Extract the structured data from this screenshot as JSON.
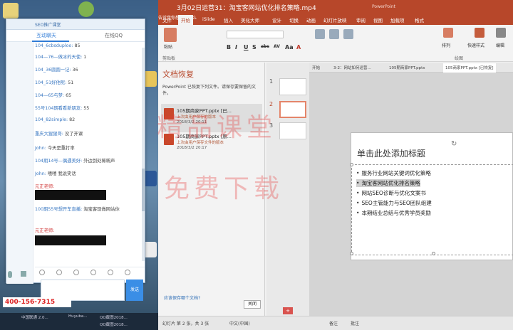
{
  "window_title": "3月02日运营31：淘宝客网站优化排名策略.mp4",
  "app_name": "PowerPoint",
  "chat": {
    "title": "SEO推广课堂",
    "tabs": [
      "互动聊天",
      "在线QQ"
    ],
    "messages": [
      {
        "user": "104_6cbsduploo:",
        "text": "85",
        "red": false
      },
      {
        "user": "104—76—做冰的天使:",
        "text": "1",
        "red": false
      },
      {
        "user": "104_36圆圆一记:",
        "text": "36",
        "red": false
      },
      {
        "user": "104_51好他呢:",
        "text": "51",
        "red": false
      },
      {
        "user": "104—65与梦:",
        "text": "65",
        "red": false
      },
      {
        "user": "55号104期看看新朋友:",
        "text": "55",
        "red": false
      },
      {
        "user": "104_82simple:",
        "text": "82",
        "red": false
      },
      {
        "user": "重庆大猩猩哥:",
        "text": "没了开课",
        "red": false
      },
      {
        "user": "John:",
        "text": "今天是重打率",
        "red": false
      },
      {
        "user": "104期14号—偶遇美好:",
        "text": "外边到处稀稀声",
        "red": false
      },
      {
        "user": "John:",
        "text": "嘻嘻 我说笑话",
        "red": false
      },
      {
        "user": "元正老师:",
        "text": "",
        "red": true
      },
      {
        "user": "100期55号想开车直播:",
        "text": "淘宝客现做网站你",
        "red": false
      },
      {
        "user": "元正老师:",
        "text": "",
        "red": true
      }
    ],
    "send_label": "发送"
  },
  "ribbon": {
    "tabs": [
      "文件",
      "开始",
      "iSlide",
      "插入",
      "美化大师",
      "设计",
      "切换",
      "动画",
      "幻灯片放映",
      "审阅",
      "视图",
      "加载项",
      "格式"
    ],
    "active_tab": "开始",
    "search_hint": "告诉我你想要做什么",
    "paste_label": "粘贴",
    "clipboard_group": "剪贴板",
    "draw_group": "绘图",
    "font_letters": [
      "B",
      "I",
      "U",
      "S",
      "abc",
      "AV",
      "Aa",
      "A"
    ],
    "align_label": "排列",
    "quick_style": "快速样式",
    "edit_label": "编辑"
  },
  "recovery": {
    "title": "文档恢复",
    "description": "PowerPoint 已恢复下列文件。请保存要保留的文件。",
    "items": [
      {
        "name": "105期商家PPT.pptx [已...",
        "sub": "上次由用户保存的版本",
        "time": "2018/3/2 20:11",
        "selected": true
      },
      {
        "name": "105期商家PPT.pptx [原...",
        "sub": "上次由用户保存文件的版本",
        "time": "2018/3/2 20:17",
        "selected": false
      }
    ],
    "help": "应该保存哪个文档?",
    "close": "关闭"
  },
  "doc_tabs": [
    "开始",
    "3-2：网站如何运营...",
    "105期商家PPT.pptx",
    "105商家PPT.pptx [已恢复]"
  ],
  "thumb_numbers": [
    "1",
    "2",
    "3"
  ],
  "slide": {
    "title": "单击此处添加标题",
    "bullets": [
      {
        "text": "服务行业网站关键词优化策略",
        "highlight": false
      },
      {
        "text": "淘宝客网站优化排名策略",
        "highlight": true
      },
      {
        "text": "网站SEO诊断与优化文案书",
        "highlight": false
      },
      {
        "text": "SEO主管能力与SEO团队组建",
        "highlight": false
      },
      {
        "text": "本期结业总结与优秀学员奖励",
        "highlight": false
      }
    ]
  },
  "status": {
    "slide_info": "幻灯片 第 2 张，共 3 张",
    "lang": "中文(中国)",
    "notes": "备注",
    "comments": "批注"
  },
  "watermark": [
    "精品课堂",
    "免费下载"
  ],
  "desktop": {
    "phone": "400-156-7315",
    "taskbar_items": [
      "中国联通 2.0...",
      "Huyuba...",
      "QQ截图2018...",
      "QQ截图2018..."
    ]
  }
}
